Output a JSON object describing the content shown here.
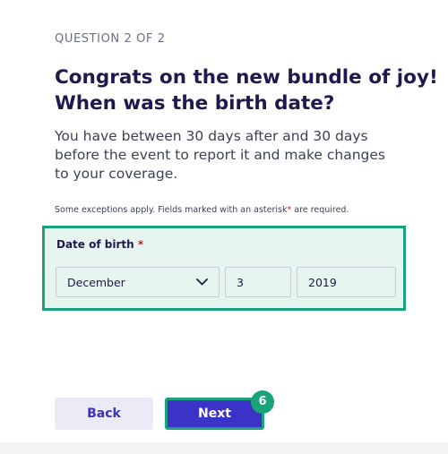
{
  "eyebrow": "QUESTION 2 OF 2",
  "headline": {
    "line1": "Congrats on the new bundle of joy!",
    "line2": "When was the birth date?"
  },
  "subtext": {
    "line1": "You have between 30 days after and 30 days",
    "line2": "before the event to report it and make changes",
    "line3": "to your coverage."
  },
  "fine_print": {
    "before": "Some exceptions apply. Fields marked with an asterisk",
    "star": "*",
    "after": " are required."
  },
  "dob": {
    "label": "Date of birth",
    "star": "*",
    "month": "December",
    "day": "3",
    "year": "2019"
  },
  "actions": {
    "back": "Back",
    "next": "Next"
  },
  "step_badge": "6",
  "colors": {
    "highlight": "#1aa37a",
    "primary": "#3b32c8",
    "required": "#c81e1e"
  }
}
